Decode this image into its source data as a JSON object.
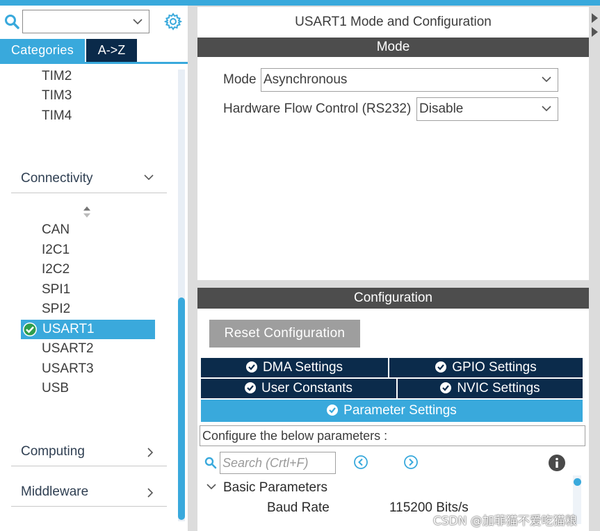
{
  "colors": {
    "accent": "#39a9dc",
    "navy": "#0b2b4b",
    "header_gray": "#4d4d4d",
    "button_gray": "#9e9e9e",
    "check_green": "#2e9e4e"
  },
  "left_panel": {
    "search": {
      "value": "",
      "icon": "search-icon"
    },
    "settings_icon": "gear-icon",
    "tabs": [
      {
        "label": "Categories",
        "active": true
      },
      {
        "label": "A->Z",
        "active": false
      }
    ],
    "timers_items": [
      "TIM2",
      "TIM3",
      "TIM4"
    ],
    "groups": {
      "connectivity": "Connectivity",
      "computing": "Computing",
      "middleware": "Middleware"
    },
    "connectivity_items": [
      "CAN",
      "I2C1",
      "I2C2",
      "SPI1",
      "SPI2",
      "USART1",
      "USART2",
      "USART3",
      "USB"
    ],
    "selected_item": "USART1"
  },
  "mode_panel": {
    "title": "USART1 Mode and Configuration",
    "header": "Mode",
    "mode_label": "Mode",
    "mode_value": "Asynchronous",
    "flow_label": "Hardware Flow Control (RS232)",
    "flow_value": "Disable"
  },
  "config_panel": {
    "header": "Configuration",
    "reset_label": "Reset Configuration",
    "tabs": {
      "dma": "DMA Settings",
      "gpio": "GPIO Settings",
      "user_constants": "User Constants",
      "nvic": "NVIC Settings",
      "parameter": "Parameter Settings"
    },
    "active_tab": "Parameter Settings",
    "description": "Configure the below parameters :",
    "search_placeholder": "Search (Crtl+F)",
    "section": "Basic Parameters",
    "params": [
      {
        "name": "Baud Rate",
        "value": "115200 Bits/s"
      }
    ]
  },
  "watermark": "CSDN @加菲猫不爱吃猫粮"
}
